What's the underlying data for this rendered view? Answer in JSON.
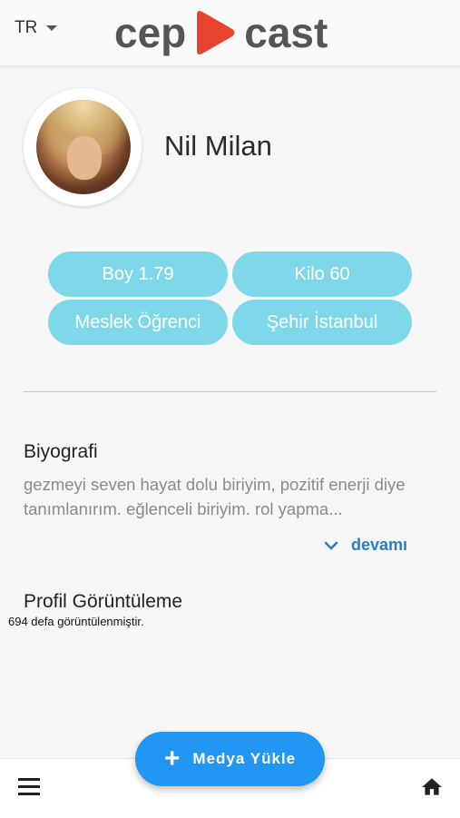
{
  "header": {
    "language": "TR",
    "logo_left": "cep",
    "logo_right": "cast",
    "logo_icon": "play-icon",
    "accent_color": "#e8432e"
  },
  "profile": {
    "name": "Nil Milan",
    "avatar_icon": "profile-photo"
  },
  "chips": [
    {
      "label": "Boy 1.79"
    },
    {
      "label": "Kilo 60"
    },
    {
      "label": "Meslek Öğrenci"
    },
    {
      "label": "Şehir İstanbul"
    }
  ],
  "chip_color": "#7ed8e9",
  "biography": {
    "title": "Biyografi",
    "text": "gezmeyi seven hayat dolu biriyim, pozitif enerji diye tanımlanırım. eğlenceli biriyim. rol yapma...",
    "more_label": "devamı"
  },
  "views": {
    "title": "Profil Görüntüleme",
    "text": "694 defa görüntülenmiştir."
  },
  "fab": {
    "label": "Medya Yükle",
    "color": "#2196f3"
  },
  "bottom_nav": {
    "menu_icon": "menu-icon",
    "home_icon": "home-icon"
  }
}
